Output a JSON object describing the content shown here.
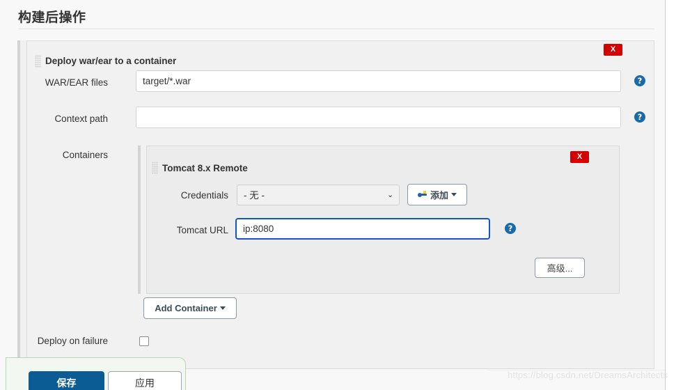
{
  "page": {
    "title": "构建后操作"
  },
  "builder": {
    "title": "Deploy war/ear to a container",
    "delete_label": "X",
    "fields": {
      "war_files": {
        "label": "WAR/EAR files",
        "value": "target/*.war",
        "placeholder": "",
        "help": "?"
      },
      "context_path": {
        "label": "Context path",
        "value": "",
        "placeholder": "",
        "help": "?"
      },
      "containers": {
        "label": "Containers"
      },
      "deploy_on_failure": {
        "label": "Deploy on failure",
        "checked": false
      }
    },
    "add_container_button": {
      "label": "Add Container",
      "caret": "▾"
    }
  },
  "container_panel": {
    "title": "Tomcat 8.x Remote",
    "delete_label": "X",
    "credentials": {
      "label": "Credentials",
      "selected": "- 无 -",
      "options": [
        "- 无 -"
      ],
      "caret": "⌄",
      "add_button": {
        "label": "添加",
        "icon": "key-icon",
        "caret": "▾"
      }
    },
    "tomcat_url": {
      "label": "Tomcat URL",
      "value": "ip:8080",
      "placeholder": "",
      "focused": true,
      "help": "?"
    },
    "advanced_button": {
      "label": "高级..."
    }
  },
  "save_bar": {
    "save_label": "保存",
    "apply_label": "应用"
  },
  "watermark": {
    "text": "https://blog.csdn.net/DreamsArchitects"
  },
  "colors": {
    "danger": "#d40000",
    "help_blue": "#1a6aa8",
    "focus_blue": "#1155cc",
    "primary": "#0b5c94",
    "save_bar_bg": "#f2f7f2",
    "save_bar_border": "#b9d6b9"
  }
}
